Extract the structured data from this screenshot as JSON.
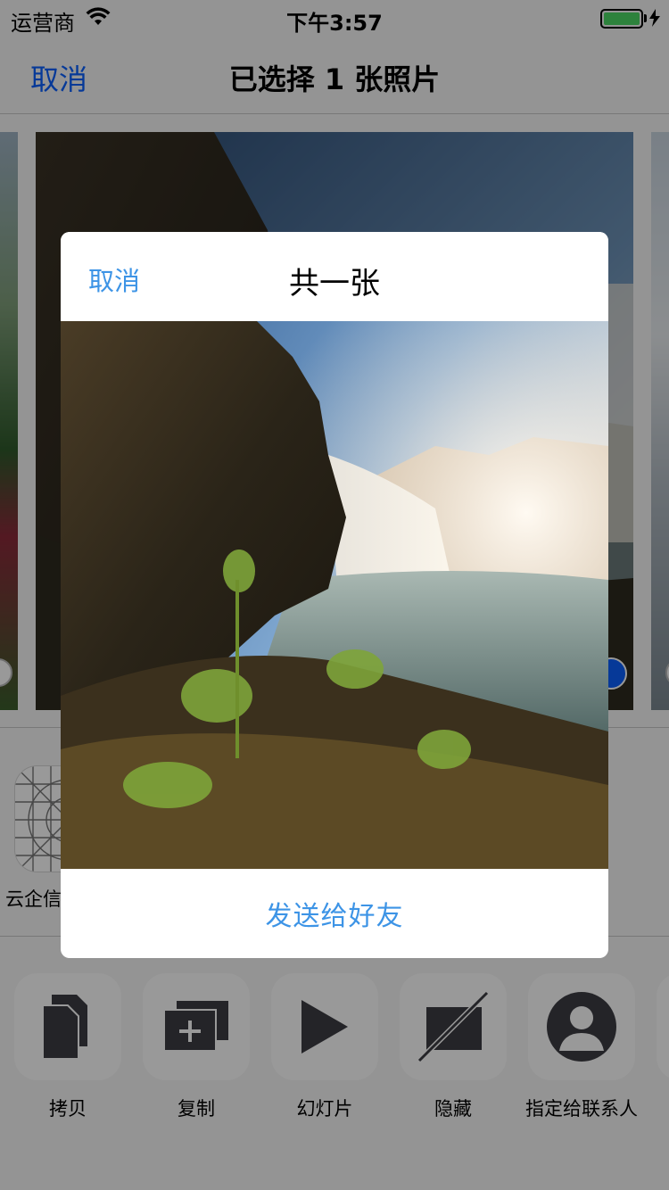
{
  "status_bar": {
    "carrier": "运营商",
    "time": "下午3:57",
    "battery_color": "#4cd964"
  },
  "nav": {
    "cancel_label": "取消",
    "title": "已选择 1 张照片"
  },
  "share_apps": [
    {
      "label": "云企信",
      "icon": "grid-logo-icon"
    }
  ],
  "actions": [
    {
      "label": "拷贝",
      "icon": "copy-icon"
    },
    {
      "label": "复制",
      "icon": "duplicate-icon"
    },
    {
      "label": "幻灯片",
      "icon": "play-icon"
    },
    {
      "label": "隐藏",
      "icon": "hide-icon"
    },
    {
      "label": "指定给联系人",
      "icon": "contact-icon"
    }
  ],
  "dialog": {
    "cancel_label": "取消",
    "title": "共一张",
    "send_label": "发送给好友"
  },
  "colors": {
    "ios_blue": "#0a60fe",
    "dialog_blue": "#3d94e6"
  }
}
